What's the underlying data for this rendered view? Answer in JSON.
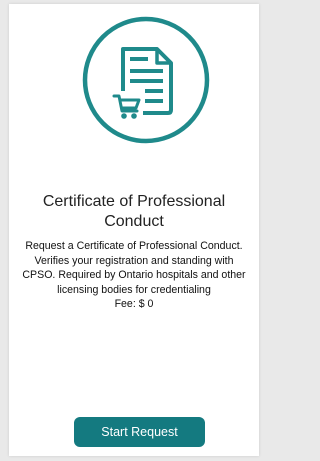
{
  "card": {
    "icon": "certificate-document-cart-icon",
    "title_line1": "Certificate of Professional",
    "title_line2": "Conduct",
    "description_lines": [
      "Request a Certificate of Professional Conduct.",
      "Verifies your registration and standing with",
      "CPSO. Required by Ontario hospitals and other",
      "licensing bodies for credentialing"
    ],
    "fee": "Fee: $ 0",
    "button_label": "Start Request"
  },
  "colors": {
    "accent": "#147a80",
    "icon_teal": "#1f8a8b",
    "background": "#e9e9e9",
    "card": "#ffffff"
  }
}
